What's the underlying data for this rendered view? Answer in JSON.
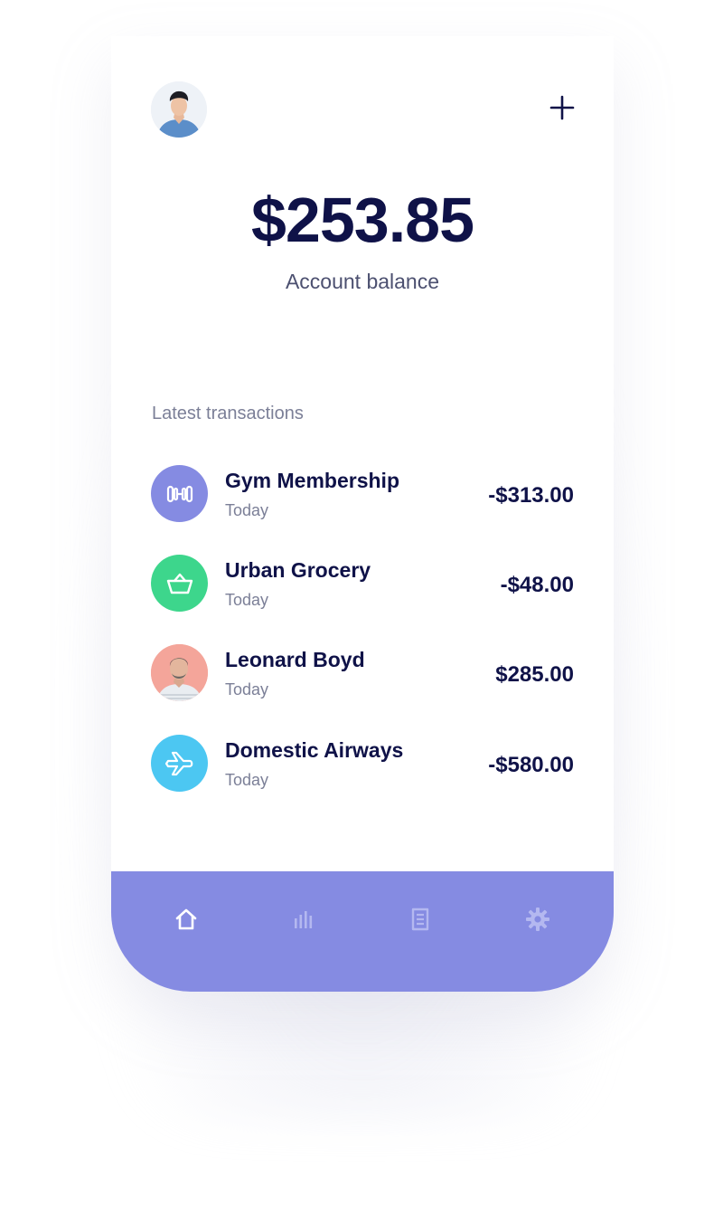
{
  "header": {
    "avatar_icon": "user-avatar",
    "add_icon": "plus-icon"
  },
  "balance": {
    "amount": "$253.85",
    "label": "Account balance"
  },
  "transactions": {
    "title": "Latest transactions",
    "items": [
      {
        "name": "Gym Membership",
        "date": "Today",
        "amount": "-$313.00",
        "icon": "dumbbell-icon",
        "color": "#858be2"
      },
      {
        "name": "Urban Grocery",
        "date": "Today",
        "amount": "-$48.00",
        "icon": "basket-icon",
        "color": "#3dd68c"
      },
      {
        "name": "Leonard Boyd",
        "date": "Today",
        "amount": "$285.00",
        "icon": "person-avatar",
        "color": "#f4a59a"
      },
      {
        "name": "Domestic Airways",
        "date": "Today",
        "amount": "-$580.00",
        "icon": "airplane-icon",
        "color": "#4cc7f2"
      }
    ]
  },
  "nav": {
    "background": "#858be2",
    "items": [
      {
        "icon": "home-icon",
        "active": true
      },
      {
        "icon": "bar-chart-icon",
        "active": false
      },
      {
        "icon": "receipt-icon",
        "active": false
      },
      {
        "icon": "gear-icon",
        "active": false
      }
    ]
  },
  "colors": {
    "text_primary": "#0f1248",
    "text_secondary": "#7b7f97",
    "accent": "#858be2"
  }
}
